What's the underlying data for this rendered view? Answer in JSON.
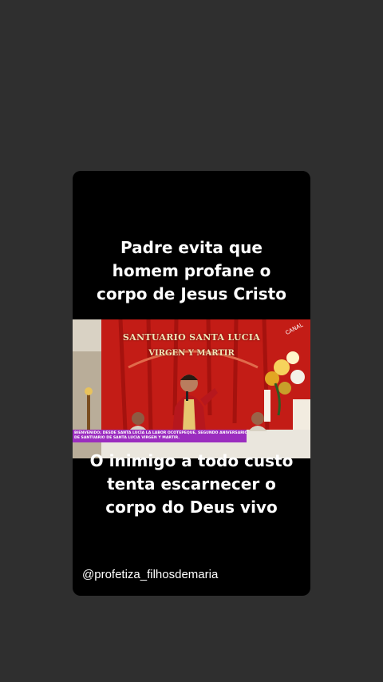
{
  "story": {
    "caption_top": [
      "Padre evita que",
      "homem profane o",
      "corpo de Jesus Cristo"
    ],
    "caption_bottom": [
      "O inimigo a todo custo",
      "tenta escarnecer o",
      "corpo do Deus vivo"
    ],
    "video": {
      "sign_line_1": "SANTUARIO SANTA LUCIA",
      "sign_line_2": "VIRGEN Y MARTIR",
      "corner_text": "CANAL",
      "ticker_line_1": "BIENVENIDO; DESDE SANTA LUCÍA LA LABOR OCOTEPEQUE, SEGUNDO ANIVERSARIO",
      "ticker_line_2": "DE SANTUARIO DE SANTA LUCIA VIRGEN Y MARTIR."
    },
    "handle": "@profetiza_filhosdemaria"
  },
  "colors": {
    "background": "#2f2f2f",
    "card": "#000000",
    "altar_red": "#c31c16",
    "ticker": "#9b2dbf"
  }
}
